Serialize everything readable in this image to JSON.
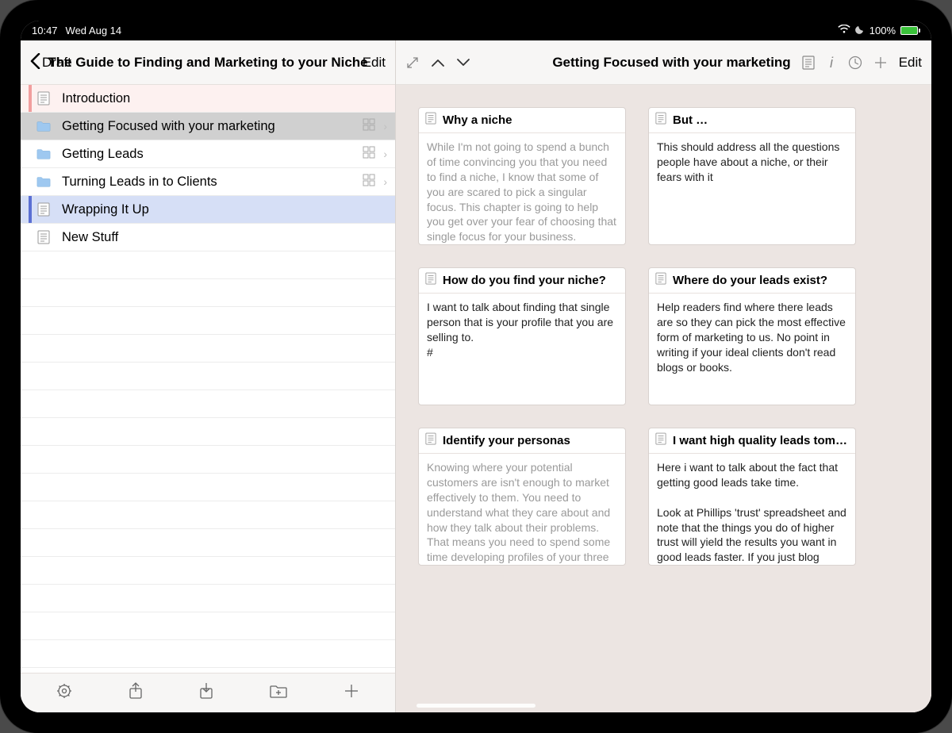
{
  "status": {
    "time": "10:47",
    "date": "Wed Aug 14",
    "battery": "100%"
  },
  "left": {
    "back_label": "Draft",
    "title": "The Guide to Finding and Marketing to your Niche",
    "edit_label": "Edit",
    "items": [
      {
        "label": "Introduction",
        "type": "doc",
        "style": "intro"
      },
      {
        "label": "Getting Focused with your marketing",
        "type": "folder",
        "style": "selected",
        "has_trailing": true
      },
      {
        "label": "Getting Leads",
        "type": "folder",
        "has_trailing": true
      },
      {
        "label": "Turning Leads in to Clients",
        "type": "folder",
        "has_trailing": true
      },
      {
        "label": "Wrapping It Up",
        "type": "doc",
        "style": "wrapping"
      },
      {
        "label": "New Stuff",
        "type": "doc"
      }
    ]
  },
  "right": {
    "title": "Getting Focused with your marketing",
    "edit_label": "Edit",
    "cards": [
      [
        {
          "title": "Why a niche",
          "body": "While I'm not going to spend a bunch of time convincing you that you need to find a niche, I know that some of you are scared to pick a singular focus. This chapter is going to help you get over your fear of choosing that single focus for your business. Marketing is all about getting people to know, like, trust, an…",
          "muted": true
        },
        {
          "title": "But …",
          "body": "This should address all the questions people have about a niche, or their fears with it"
        }
      ],
      [
        {
          "title": "How do you find your niche?",
          "body": "I want to talk about finding that single person that is your profile that you are selling to.\n#"
        },
        {
          "title": "Where do your leads exist?",
          "body": "Help readers find where there leads are so they can pick the most effective form of marketing to us. No point in writing if your ideal clients don't read blogs or books."
        }
      ],
      [
        {
          "title": "Identify your personas",
          "body": "Knowing where your potential customers are isn't enough to market effectively to them. You need to understand what they care about and how they talk about their problems. That means you need to spend some time developing profiles of your three main clients and then witch each marketing piece, you n…",
          "muted": true
        },
        {
          "title": "I want high quality leads tomorrow",
          "body": "Here i want to talk about the fact that getting good leads take time.\n\nLook at Phillips 'trust' spreadsheet and note that the things you do of higher trust will yield the results you want in good leads faster. If you just blog instead of speak then…"
        }
      ]
    ]
  }
}
